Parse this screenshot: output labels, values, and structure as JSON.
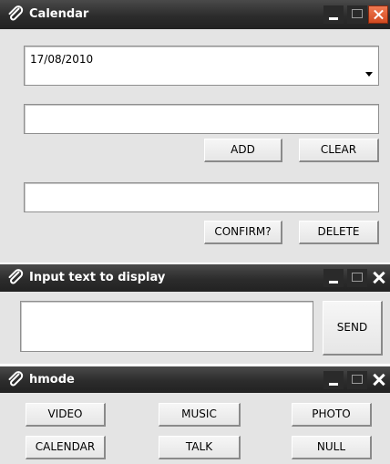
{
  "calendar_window": {
    "title": "Calendar",
    "date_value": "17/08/2010",
    "entry_field_value": "",
    "add_label": "ADD",
    "clear_label": "CLEAR",
    "confirm_field_value": "",
    "confirm_label": "CONFIRM?",
    "delete_label": "DELETE",
    "close_button_color": "#e0542a"
  },
  "input_window": {
    "title": "Input text to display",
    "text_value": "",
    "send_label": "SEND"
  },
  "hmode_window": {
    "title": "hmode",
    "buttons": [
      "VIDEO",
      "MUSIC",
      "PHOTO",
      "CALENDAR",
      "TALK",
      "NULL"
    ]
  },
  "icons": {
    "title_icon": "paperclip-icon",
    "minimize": "minimize-icon",
    "maximize": "maximize-icon",
    "close": "close-icon",
    "dropdown": "chevron-down-icon"
  }
}
